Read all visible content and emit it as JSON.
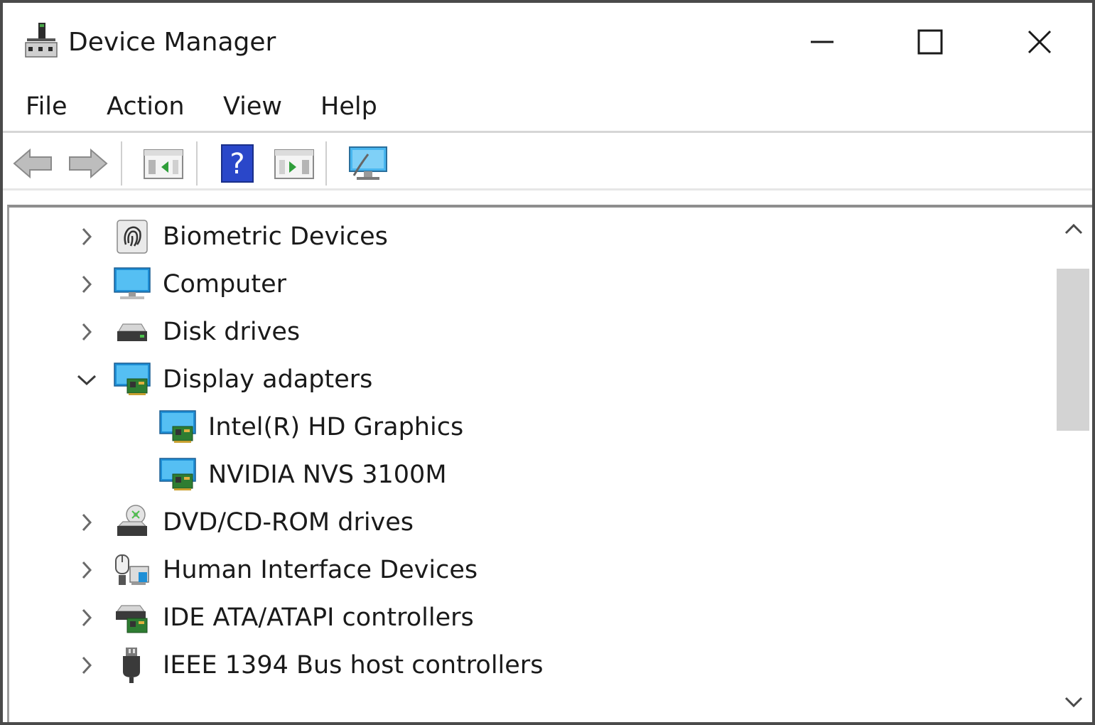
{
  "window": {
    "title": "Device Manager"
  },
  "menu": {
    "items": [
      "File",
      "Action",
      "View",
      "Help"
    ]
  },
  "toolbar": {
    "icons": [
      "back-arrow-icon",
      "forward-arrow-icon",
      "show-hide-console-tree-icon",
      "help-icon",
      "show-action-pane-icon",
      "scan-hardware-monitor-icon"
    ]
  },
  "tree": {
    "nodes": [
      {
        "label": "Biometric Devices",
        "state": "collapsed",
        "icon": "fingerprint-icon"
      },
      {
        "label": "Computer",
        "state": "collapsed",
        "icon": "computer-monitor-icon"
      },
      {
        "label": "Disk drives",
        "state": "collapsed",
        "icon": "disk-drive-icon"
      },
      {
        "label": "Display adapters",
        "state": "expanded",
        "icon": "display-adapter-icon",
        "children": [
          {
            "label": "Intel(R) HD Graphics",
            "icon": "display-adapter-icon"
          },
          {
            "label": "NVIDIA NVS 3100M",
            "icon": "display-adapter-icon"
          }
        ]
      },
      {
        "label": "DVD/CD-ROM drives",
        "state": "collapsed",
        "icon": "dvd-drive-icon"
      },
      {
        "label": "Human Interface Devices",
        "state": "collapsed",
        "icon": "hid-icon"
      },
      {
        "label": "IDE ATA/ATAPI controllers",
        "state": "collapsed",
        "icon": "ide-controller-icon"
      },
      {
        "label": "IEEE 1394 Bus host controllers",
        "state": "collapsed",
        "icon": "ieee1394-icon"
      }
    ]
  },
  "colors": {
    "accent_blue": "#1e8fd6",
    "help_blue": "#2a47c9",
    "scroll_thumb": "#d3d3d3"
  }
}
